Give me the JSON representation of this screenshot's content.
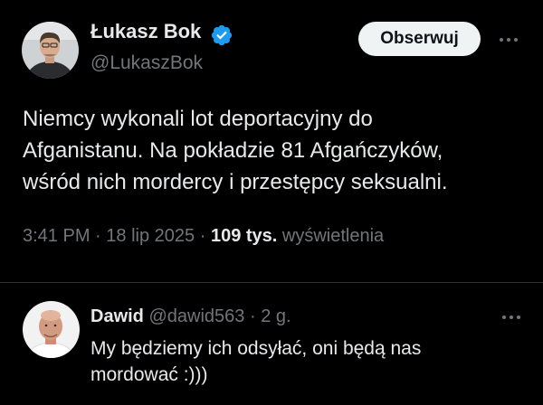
{
  "tweet": {
    "author_name": "Łukasz Bok",
    "author_handle": "@LukaszBok",
    "follow_label": "Obserwuj",
    "text_lines": [
      "Niemcy wykonali lot deportacyjny do",
      "Afganistanu. Na pokładzie 81 Afgańczyków,",
      "wśród nich mordercy i przestępcy seksualni."
    ],
    "time": "3:41 PM",
    "date": "18 lip 2025",
    "views_count": "109 tys.",
    "views_label": "wyświetlenia",
    "separator": "·"
  },
  "reply": {
    "author_name": "Dawid",
    "author_handle": "@dawid563",
    "age": "2 g.",
    "text_lines": [
      "My będziemy ich odsyłać, oni będą nas",
      "mordować :)))"
    ]
  },
  "colors": {
    "background": "#000000",
    "text": "#e7e9ea",
    "secondary": "#71767b",
    "verified": "#1d9bf0",
    "follow_bg": "#eff3f4"
  },
  "icons": {
    "verified": "verified-badge-icon",
    "more": "more-horizontal-icon"
  }
}
